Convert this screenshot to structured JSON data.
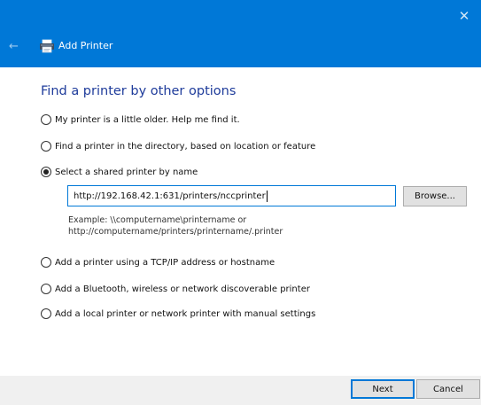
{
  "window": {
    "title": "Add Printer",
    "close_glyph": "✕",
    "back_glyph": "←",
    "accent_color": "#0078d7"
  },
  "heading": "Find a printer by other options",
  "options": [
    {
      "label": "My printer is a little older. Help me find it.",
      "selected": false
    },
    {
      "label": "Find a printer in the directory, based on location or feature",
      "selected": false
    },
    {
      "label": "Select a shared printer by name",
      "selected": true
    },
    {
      "label": "Add a printer using a TCP/IP address or hostname",
      "selected": false
    },
    {
      "label": "Add a Bluetooth, wireless or network discoverable printer",
      "selected": false
    },
    {
      "label": "Add a local printer or network printer with manual settings",
      "selected": false
    }
  ],
  "shared_printer": {
    "value": "http://192.168.42.1:631/printers/nccprinter",
    "browse_label": "Browse...",
    "example_line1": "Example: \\\\computername\\printername or",
    "example_line2": "http://computername/printers/printername/.printer"
  },
  "footer": {
    "next_label": "Next",
    "cancel_label": "Cancel"
  },
  "icons": {
    "app": "printer-icon"
  }
}
